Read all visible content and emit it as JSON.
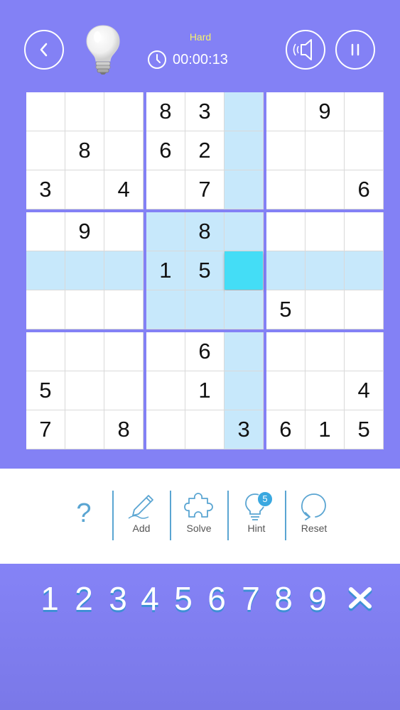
{
  "header": {
    "difficulty": "Hard",
    "timer": "00:00:13"
  },
  "colors": {
    "background": "#8381f5",
    "difficulty": "#f5f26a",
    "highlight": "#c7e8fb",
    "selected": "#44ddf6",
    "icon_blue": "#5aa5d2"
  },
  "board": {
    "rows": [
      [
        "",
        "",
        "",
        "8",
        "3",
        "",
        "",
        "9",
        ""
      ],
      [
        "",
        "8",
        "",
        "6",
        "2",
        "",
        "",
        "",
        ""
      ],
      [
        "3",
        "",
        "4",
        "",
        "7",
        "",
        "",
        "",
        "6"
      ],
      [
        "",
        "9",
        "",
        "",
        "8",
        "",
        "",
        "",
        ""
      ],
      [
        "",
        "",
        "",
        "1",
        "5",
        "",
        "",
        "",
        ""
      ],
      [
        "",
        "",
        "",
        "",
        "",
        "",
        "5",
        "",
        ""
      ],
      [
        "",
        "",
        "",
        "",
        "6",
        "",
        "",
        "",
        ""
      ],
      [
        "5",
        "",
        "",
        "",
        "1",
        "",
        "",
        "",
        "4"
      ],
      [
        "7",
        "",
        "8",
        "",
        "",
        "3",
        "6",
        "1",
        "5"
      ]
    ],
    "selected": [
      4,
      5
    ]
  },
  "toolbar": {
    "help_label": "?",
    "add_label": "Add",
    "solve_label": "Solve",
    "hint_label": "Hint",
    "hint_count": "5",
    "reset_label": "Reset"
  },
  "numpad": [
    "1",
    "2",
    "3",
    "4",
    "5",
    "6",
    "7",
    "8",
    "9"
  ],
  "icons": [
    "back-icon",
    "lightbulb-icon",
    "clock-icon",
    "sound-icon",
    "pause-icon",
    "pencil-icon",
    "puzzle-icon",
    "hint-bulb-icon",
    "reset-icon",
    "erase-icon"
  ]
}
